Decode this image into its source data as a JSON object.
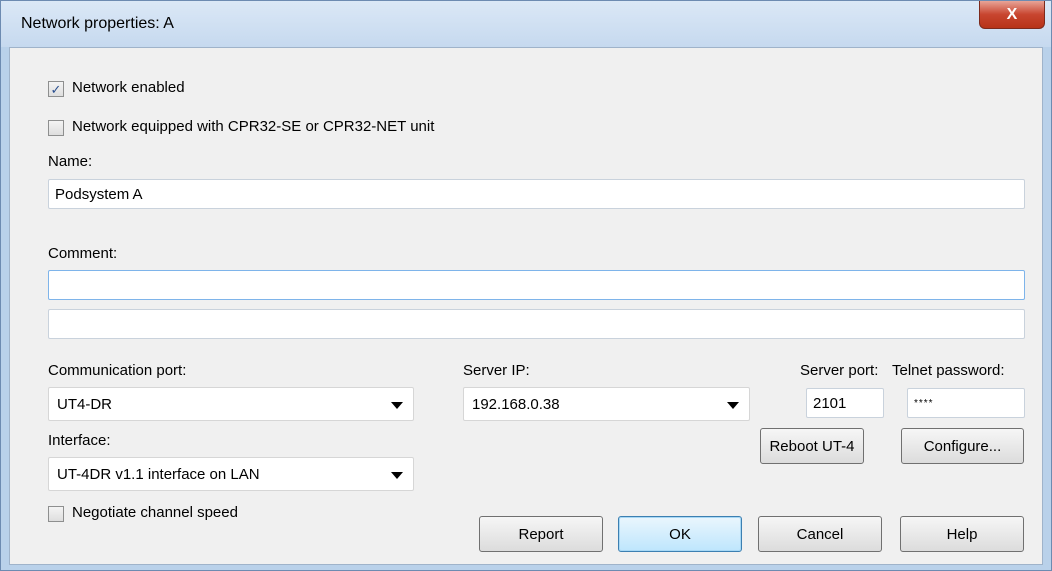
{
  "window": {
    "title": "Network properties: A",
    "close_glyph": "X"
  },
  "options": {
    "network_enabled": {
      "label": "Network enabled",
      "checked": true,
      "check_glyph": "✓"
    },
    "cpr_equipped": {
      "label": "Network equipped with CPR32-SE or CPR32-NET unit",
      "checked": false
    },
    "negotiate_speed": {
      "label": "Negotiate channel speed",
      "checked": false
    }
  },
  "name": {
    "label": "Name:",
    "value": "Podsystem A"
  },
  "comment": {
    "label": "Comment:",
    "line1": "",
    "line2": ""
  },
  "comm_port": {
    "label": "Communication port:",
    "value": "UT4-DR"
  },
  "server_ip": {
    "label": "Server IP:",
    "value": "192.168.0.38"
  },
  "server_port": {
    "label": "Server port:",
    "value": "2101"
  },
  "telnet_password": {
    "label": "Telnet password:",
    "value": "****"
  },
  "interface": {
    "label": "Interface:",
    "value": "UT-4DR v1.1 interface on LAN"
  },
  "buttons": {
    "reboot": "Reboot UT-4",
    "configure": "Configure...",
    "report": "Report",
    "ok": "OK",
    "cancel": "Cancel",
    "help": "Help"
  }
}
